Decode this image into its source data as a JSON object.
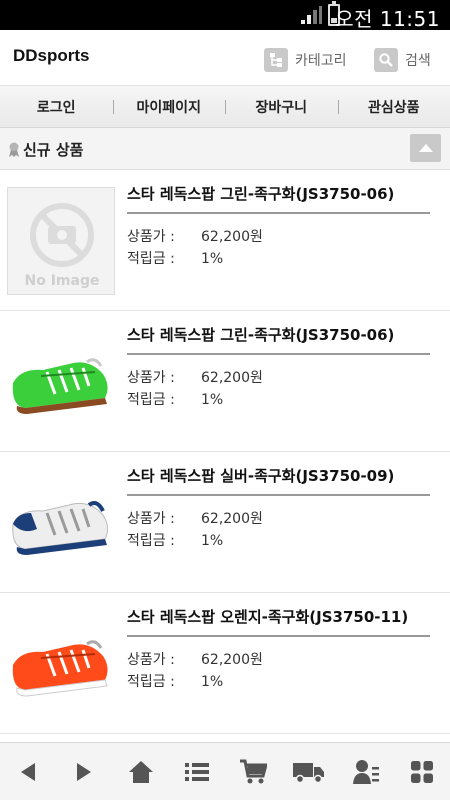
{
  "status": {
    "time": "오전 11:51"
  },
  "header": {
    "brand": "DDsports",
    "category_label": "카테고리",
    "search_label": "검색"
  },
  "menu": [
    {
      "label": "로그인"
    },
    {
      "label": "마이페이지"
    },
    {
      "label": "장바구니"
    },
    {
      "label": "관심상품"
    }
  ],
  "section": {
    "title": "신규 상품"
  },
  "products": [
    {
      "name": "스타 레독스팝 그린-족구화(JS3750-06)",
      "price_label": "상품가 :",
      "price": "62,200원",
      "points_label": "적립금 :",
      "points": "1%",
      "image": "no-image",
      "image_text": "No Image"
    },
    {
      "name": "스타 레독스팝 그린-족구화(JS3750-06)",
      "price_label": "상품가 :",
      "price": "62,200원",
      "points_label": "적립금 :",
      "points": "1%",
      "image": "green-shoe"
    },
    {
      "name": "스타 레독스팝 실버-족구화(JS3750-09)",
      "price_label": "상품가 :",
      "price": "62,200원",
      "points_label": "적립금 :",
      "points": "1%",
      "image": "silver-shoe"
    },
    {
      "name": "스타 레독스팝 오렌지-족구화(JS3750-11)",
      "price_label": "상품가 :",
      "price": "62,200원",
      "points_label": "적립금 :",
      "points": "1%",
      "image": "orange-shoe"
    }
  ],
  "bottom_nav": [
    "back-icon",
    "forward-icon",
    "home-icon",
    "list-icon",
    "cart-icon",
    "delivery-truck-icon",
    "member-icon",
    "grid-menu-icon"
  ],
  "colors": {
    "icon_gray": "#555555",
    "statusbar": "#000000",
    "menu_bg": "#eeeeee",
    "green_shoe": "#3ccf3c",
    "orange_shoe": "#ff4a1a",
    "silver_navy": "#1c3f7a"
  }
}
